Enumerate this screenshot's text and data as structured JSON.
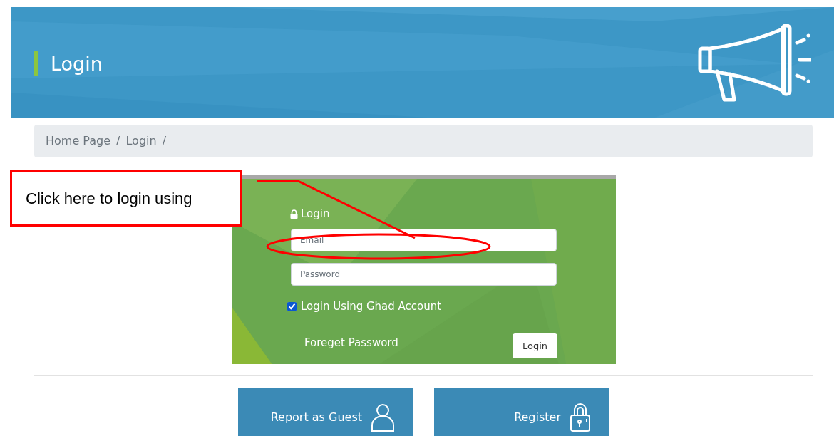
{
  "header": {
    "title": "Login"
  },
  "breadcrumb": [
    {
      "label": "Home Page",
      "separator": "/"
    },
    {
      "label": "Login",
      "separator": "/"
    }
  ],
  "login_panel": {
    "title": "Login",
    "email": {
      "placeholder": "Email"
    },
    "password": {
      "placeholder": "Password"
    },
    "ghad_account": {
      "label": "Login Using Ghad Account",
      "checked": true
    },
    "forgot_link": "Foreget Password",
    "submit": "Login"
  },
  "actions": [
    {
      "label": "Report as Guest",
      "kind": "guest"
    },
    {
      "label": "Register",
      "kind": "register"
    }
  ],
  "annotation": {
    "text": "Click here to login using"
  }
}
